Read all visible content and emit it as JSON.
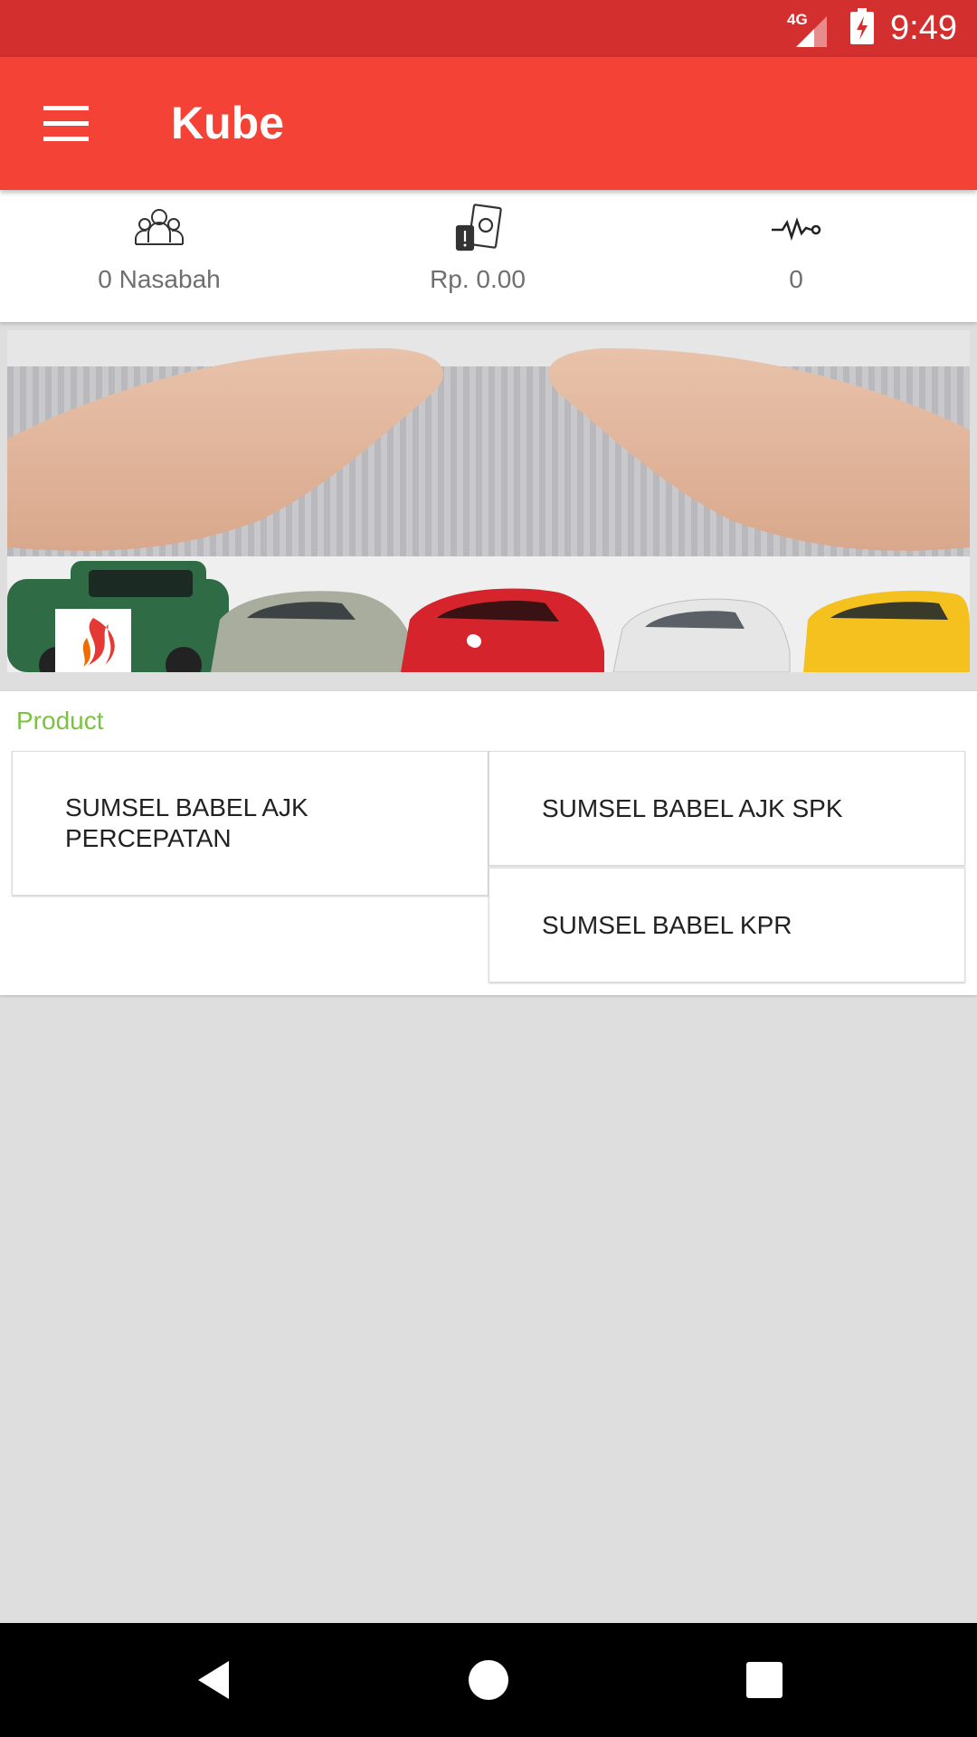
{
  "status_bar": {
    "network": "4G",
    "time": "9:49"
  },
  "app_bar": {
    "title": "Kube",
    "menu_icon": "hamburger-menu-icon"
  },
  "stats": [
    {
      "icon": "customers-icon",
      "value": "0 Nasabah"
    },
    {
      "icon": "money-icon",
      "value": "Rp. 0.00"
    },
    {
      "icon": "activity-icon",
      "value": "0"
    }
  ],
  "banner": {
    "description_icon": "insurance-banner-image",
    "logo_icon": "flame-logo-icon"
  },
  "products": {
    "heading": "Product",
    "items": [
      {
        "label": "SUMSEL BABEL AJK PERCEPATAN"
      },
      {
        "label": "SUMSEL BABEL AJK SPK"
      },
      {
        "label": "SUMSEL BABEL KPR"
      }
    ]
  },
  "colors": {
    "status_bar": "#d32f2f",
    "app_bar": "#f44336",
    "product_heading": "#7cc242",
    "background": "#dedede"
  }
}
